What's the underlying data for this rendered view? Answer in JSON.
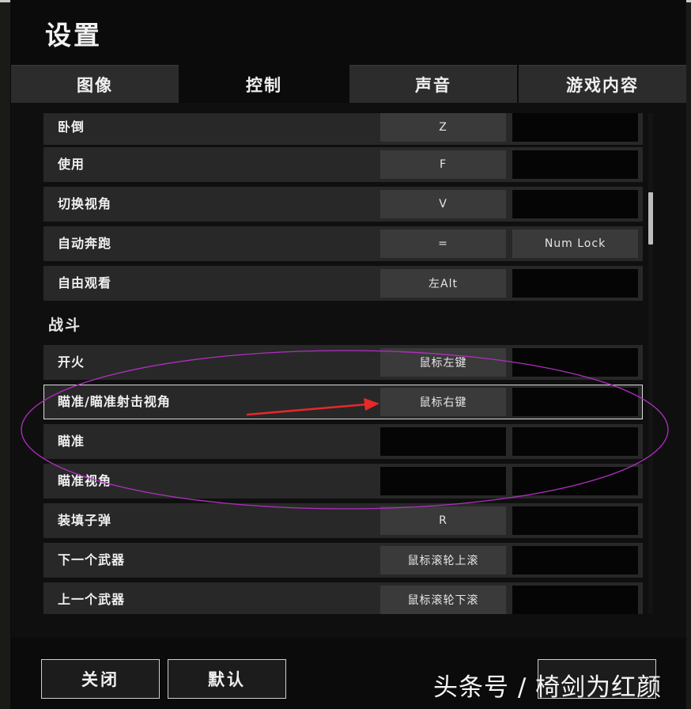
{
  "window": {
    "title": "设置"
  },
  "tabs": [
    {
      "label": "图像",
      "active": false
    },
    {
      "label": "控制",
      "active": true
    },
    {
      "label": "声音",
      "active": false
    },
    {
      "label": "游戏内容",
      "active": false
    }
  ],
  "rows_a": [
    {
      "label": "卧倒",
      "primary": "Z",
      "secondary": ""
    },
    {
      "label": "使用",
      "primary": "F",
      "secondary": ""
    },
    {
      "label": "切换视角",
      "primary": "V",
      "secondary": ""
    },
    {
      "label": "自动奔跑",
      "primary": "=",
      "secondary": "Num Lock"
    },
    {
      "label": "自由观看",
      "primary": "左Alt",
      "secondary": ""
    }
  ],
  "section_combat": "战斗",
  "rows_b": [
    {
      "label": "开火",
      "primary": "鼠标左键",
      "secondary": ""
    },
    {
      "label": "瞄准/瞄准射击视角",
      "primary": "鼠标右键",
      "secondary": "",
      "selected": true
    },
    {
      "label": "瞄准",
      "primary": "",
      "secondary": ""
    },
    {
      "label": "瞄准视角",
      "primary": "",
      "secondary": ""
    },
    {
      "label": "装填子弹",
      "primary": "R",
      "secondary": ""
    },
    {
      "label": "下一个武器",
      "primary": "鼠标滚轮上滚",
      "secondary": ""
    },
    {
      "label": "上一个武器",
      "primary": "鼠标滚轮下滚",
      "secondary": ""
    }
  ],
  "buttons": {
    "close": "关闭",
    "default": "默认"
  },
  "watermark": "头条号 / 椅剑为红颜",
  "colors": {
    "annotation_ellipse": "#b030c0",
    "annotation_arrow": "#e8282a"
  }
}
